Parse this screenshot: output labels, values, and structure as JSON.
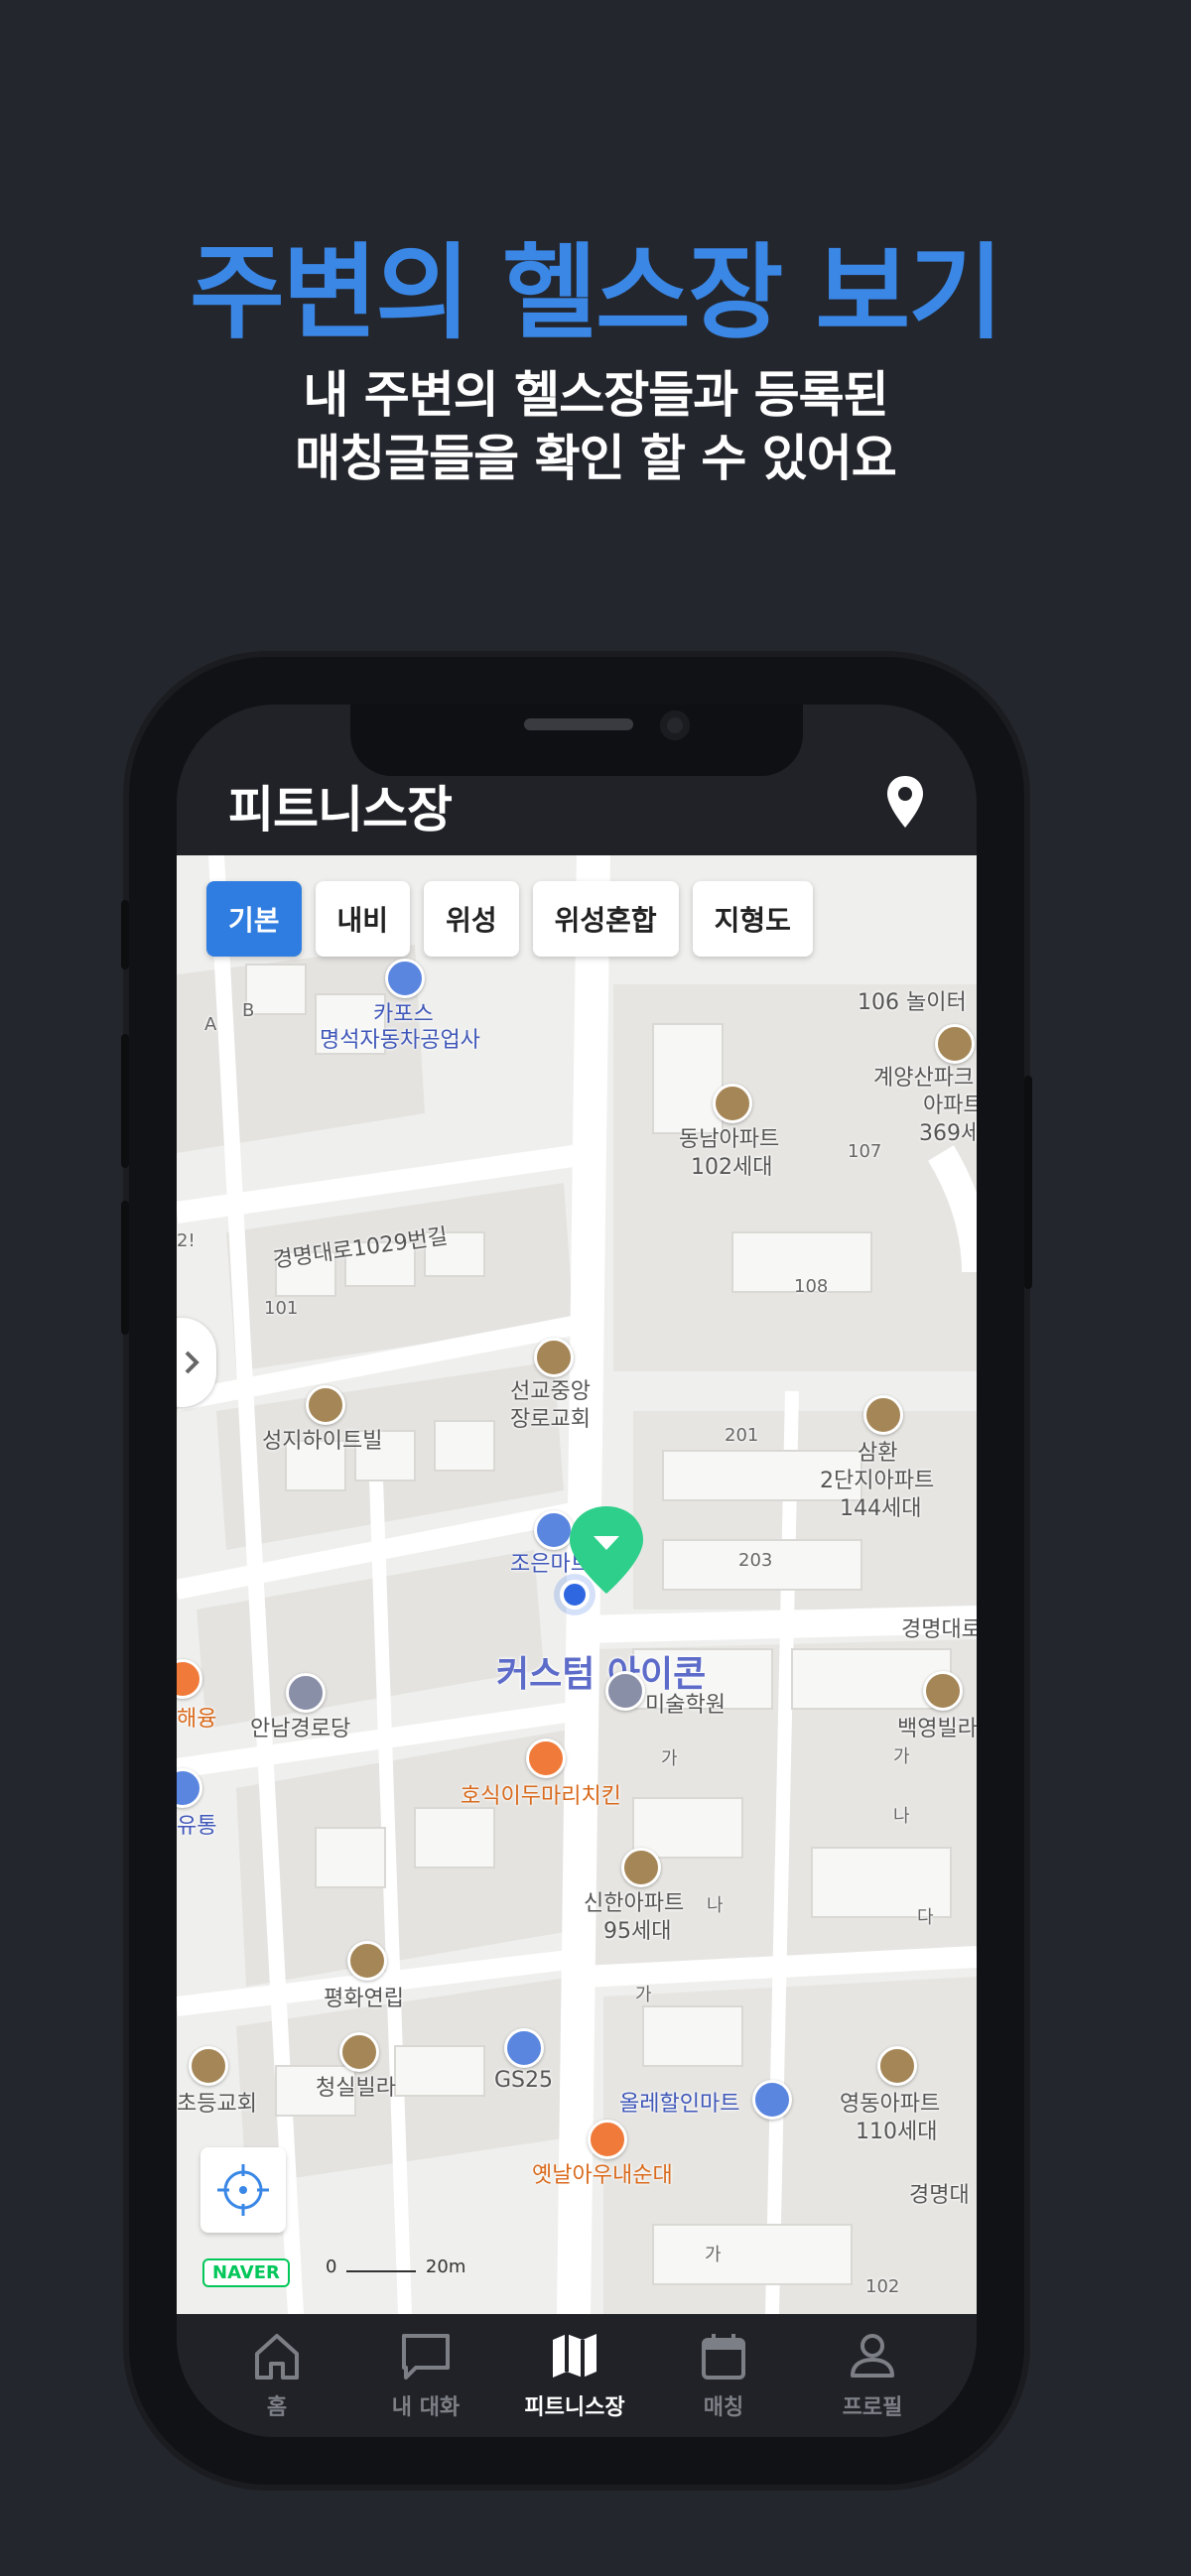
{
  "promo": {
    "headline": "주변의 헬스장 보기",
    "sub_line1": "내 주변의 헬스장들과 등록된",
    "sub_line2": "매칭글들을 확인 할 수 있어요"
  },
  "app": {
    "title": "피트니스장"
  },
  "map_types": [
    "기본",
    "내비",
    "위성",
    "위성혼합",
    "지형도"
  ],
  "map_labels": {
    "capos": "카포스",
    "myeongseok": "명석자동차공업사",
    "dongnam": "동남아파트",
    "dongnam_units": "102세대",
    "gyeyang1": "계양산파크",
    "gyeyang2": "아파트",
    "gyeyang3": "369세",
    "nolter": "106  놀이터",
    "b107": "107",
    "b108": "108",
    "road1029": "경명대로1029번길",
    "b101": "101",
    "seongyo1": "선교중앙",
    "seongyo2": "장로교회",
    "seongji": "성지하이트빌",
    "b201": "201",
    "samhwan1": "삼환",
    "samhwan2": "2단지아파트",
    "samhwan3": "144세대",
    "joeun": "조은마트",
    "b203": "203",
    "gyeongmyeong1": "경명대로",
    "custom_icon": "커스텀 아이콘",
    "art1": "미술학원",
    "baekyeong": "백영빌라",
    "annam": "안남경로당",
    "haeyung": "해융",
    "hosik": "호식이두마리치킨",
    "yutong": "유통",
    "shinhan1": "신한아파트",
    "shinhan2": "95세대",
    "pyeonghwa": "평화연립",
    "cheongsil": "청실빌라",
    "gs25": "GS25",
    "olle": "올레할인마트",
    "yeongdong1": "영동아파트",
    "yeongdong2": "110세대",
    "church": "초등교회",
    "yetnal": "옛날아우내순대",
    "gyeongmyeong2": "경명대",
    "b102": "102",
    "ga1": "가",
    "na1": "나",
    "da1": "다",
    "lot_a": "A",
    "lot_b": "B",
    "gyeongmyeong_partial": "2!"
  },
  "map_footer": {
    "brand": "NAVER",
    "scale_zero": "0",
    "scale_dist": "20m"
  },
  "tabs": [
    {
      "label": "홈",
      "icon": "home-icon"
    },
    {
      "label": "내 대화",
      "icon": "chat-icon"
    },
    {
      "label": "피트니스장",
      "icon": "map-icon",
      "active": true
    },
    {
      "label": "매칭",
      "icon": "calendar-icon"
    },
    {
      "label": "프로필",
      "icon": "profile-icon"
    }
  ],
  "colors": {
    "accent": "#3a87e6",
    "background": "#24262d",
    "marker": "#2ecf8a",
    "location": "#2f67e0"
  }
}
